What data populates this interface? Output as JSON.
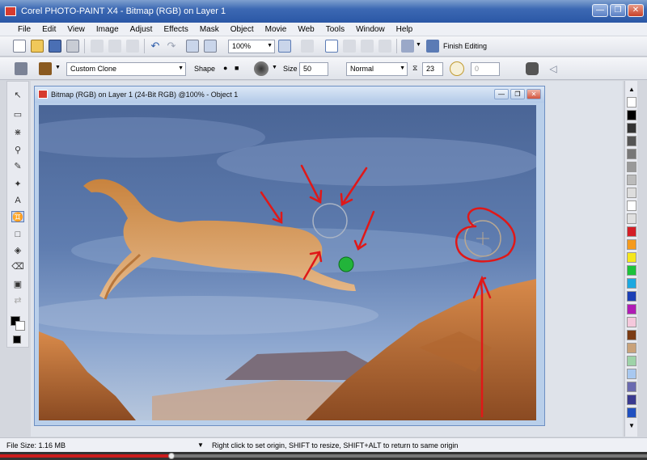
{
  "window": {
    "title": "Corel PHOTO-PAINT X4 - Bitmap (RGB) on Layer 1",
    "minimize_glyph": "—",
    "maximize_glyph": "❐",
    "close_glyph": "✕"
  },
  "menu": {
    "items": [
      "File",
      "Edit",
      "View",
      "Image",
      "Adjust",
      "Effects",
      "Mask",
      "Object",
      "Movie",
      "Web",
      "Tools",
      "Window",
      "Help"
    ]
  },
  "standard_toolbar": {
    "zoom_value": "100%",
    "finish_editing_label": "Finish Editing"
  },
  "property_bar": {
    "brush_preset": "Custom Clone",
    "shape_label": "Shape",
    "size_label": "Size",
    "size_value": "50",
    "merge_mode": "Normal",
    "transparency_value": "23",
    "second_value": "0"
  },
  "document": {
    "title": "Bitmap (RGB) on Layer 1 (24-Bit RGB) @100% - Object 1"
  },
  "palette": {
    "colors": [
      "#000000",
      "#333333",
      "#555555",
      "#777777",
      "#999999",
      "#bbbbbb",
      "#dddddd",
      "#ffffff",
      "#e0e0e0",
      "#d41e26",
      "#f59a1c",
      "#f5e61c",
      "#1cc23a",
      "#1ca8e0",
      "#1c3fb5",
      "#b01cb5",
      "#f5c8dc",
      "#7a3b14",
      "#c9a27a",
      "#9ed3a8",
      "#a8c8f0",
      "#6a6ab0",
      "#3a3a90",
      "#2050c0"
    ]
  },
  "status": {
    "file_size": "File Size: 1.16 MB",
    "hint": "Right click to set origin, SHIFT to resize, SHIFT+ALT to return to same origin"
  },
  "video": {
    "progress_fraction": 0.265
  },
  "colors": {
    "annotation_red": "#e01818",
    "clone_source_green": "#22b43a"
  },
  "icons": {
    "toolbox": [
      "pick-tool-icon",
      "mask-tool-icon",
      "mask-transform-icon",
      "zoom-tool-icon",
      "eyedropper-icon",
      "effect-tool-icon",
      "text-tool-icon",
      "clone-tool-icon",
      "rectangle-tool-icon",
      "fill-tool-icon",
      "eraser-tool-icon",
      "object-pick-icon",
      "color-swap-icon"
    ]
  }
}
